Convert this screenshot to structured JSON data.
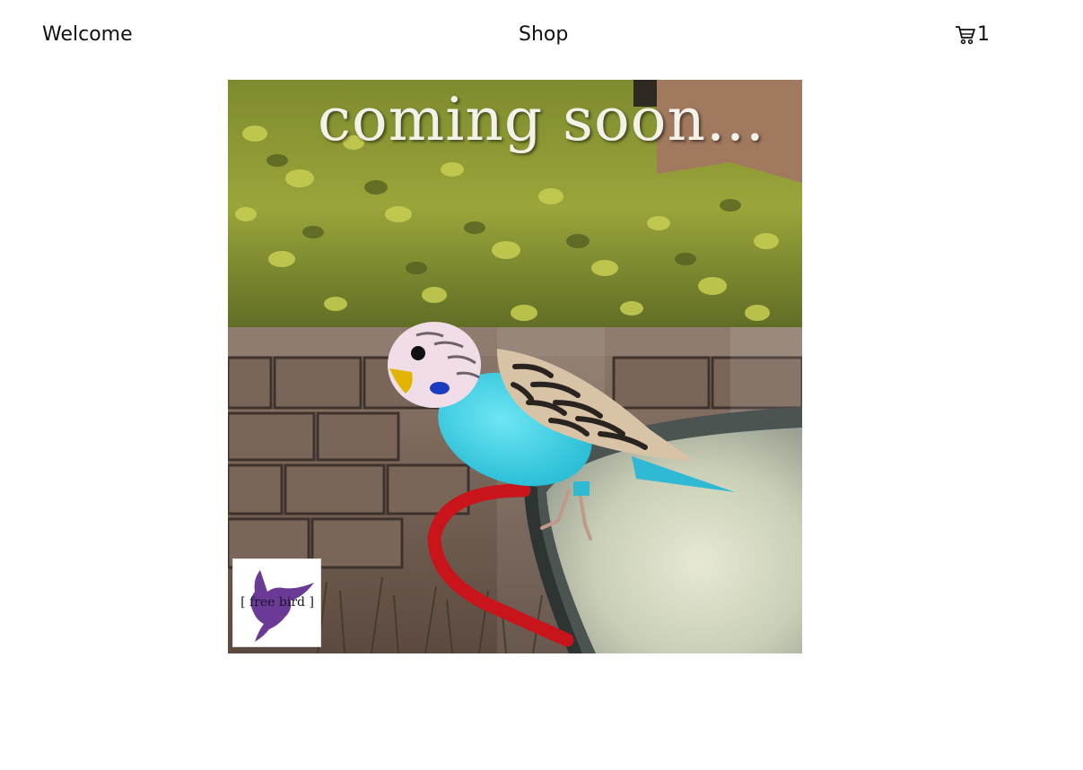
{
  "nav": {
    "welcome_label": "Welcome",
    "shop_label": "Shop",
    "cart_count": "1",
    "cart_icon": "cart-icon"
  },
  "product": {
    "banner_text": "coming soon...",
    "logo_text": "[ free bird ]",
    "logo_color": "#6a3a96",
    "parakeet_body_color": "#3ed0e6"
  }
}
